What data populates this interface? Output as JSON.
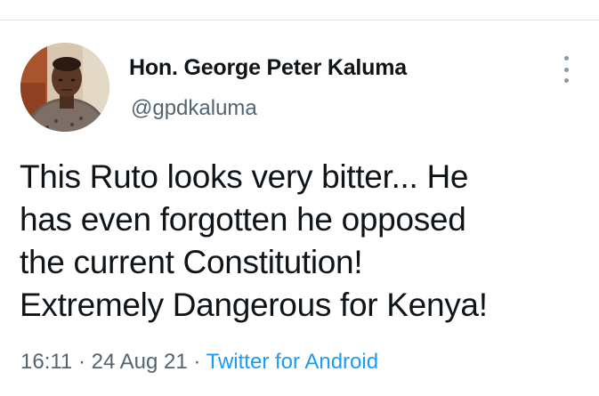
{
  "author": {
    "display_name": "Hon. George Peter Kaluma",
    "handle": "@gpdkaluma"
  },
  "tweet": {
    "lines": [
      "This Ruto looks very bitter... He",
      "has even forgotten he opposed",
      "the current Constitution!",
      "Extremely Dangerous for Kenya!"
    ],
    "time": "16:11",
    "separator": "·",
    "date": "24 Aug 21",
    "source": "Twitter for Android"
  },
  "icons": {
    "more": "more-vertical-icon"
  },
  "colors": {
    "text_primary": "#0f1419",
    "text_secondary": "#536471",
    "link": "#1d9bf0",
    "divider": "#dfe3e6"
  }
}
